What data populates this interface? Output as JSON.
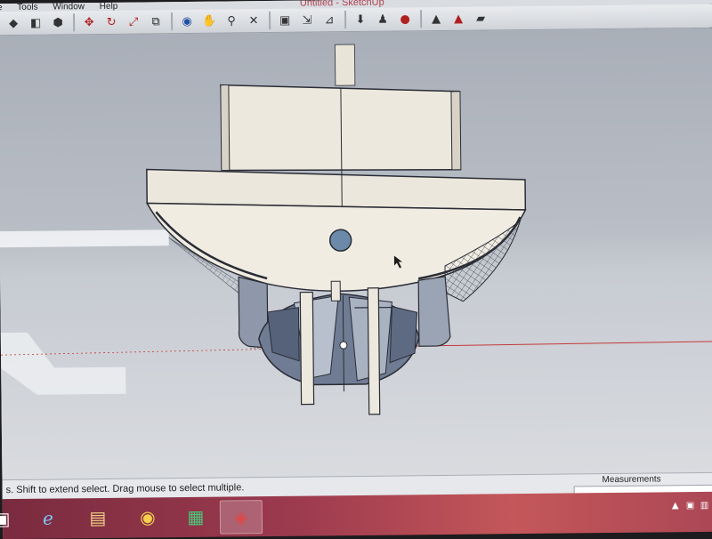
{
  "menubar": {
    "items": [
      "e",
      "Tools",
      "Window",
      "Help"
    ],
    "window_title": "Untitled - SketchUp"
  },
  "toolbar": {
    "icons": [
      "eraser-icon",
      "paint-bucket-icon",
      "push-pull-icon",
      "move-icon",
      "rotate-icon",
      "scale-icon",
      "orbit-icon",
      "pan-icon",
      "zoom-icon",
      "zoom-extents-icon",
      "section-plane-icon",
      "dimension-icon",
      "tape-measure-icon",
      "walk-icon",
      "get-models-icon",
      "share-model-icon",
      "warehouse-icon"
    ]
  },
  "status": {
    "hint": "s. Shift to extend select. Drag mouse to select multiple.",
    "measurements_label": "Measurements",
    "measurements_value": ""
  },
  "taskbar": {
    "apps": [
      "explorer-icon",
      "internet-explorer-icon",
      "file-manager-icon",
      "chrome-icon",
      "store-icon",
      "sketchup-icon"
    ],
    "active_app": "sketchup-icon"
  },
  "colors": {
    "model_face": "#ece8dd",
    "model_edge": "#2a2c35",
    "taskbar": "#9c3a4e",
    "red_axis": "#c43a3a"
  }
}
